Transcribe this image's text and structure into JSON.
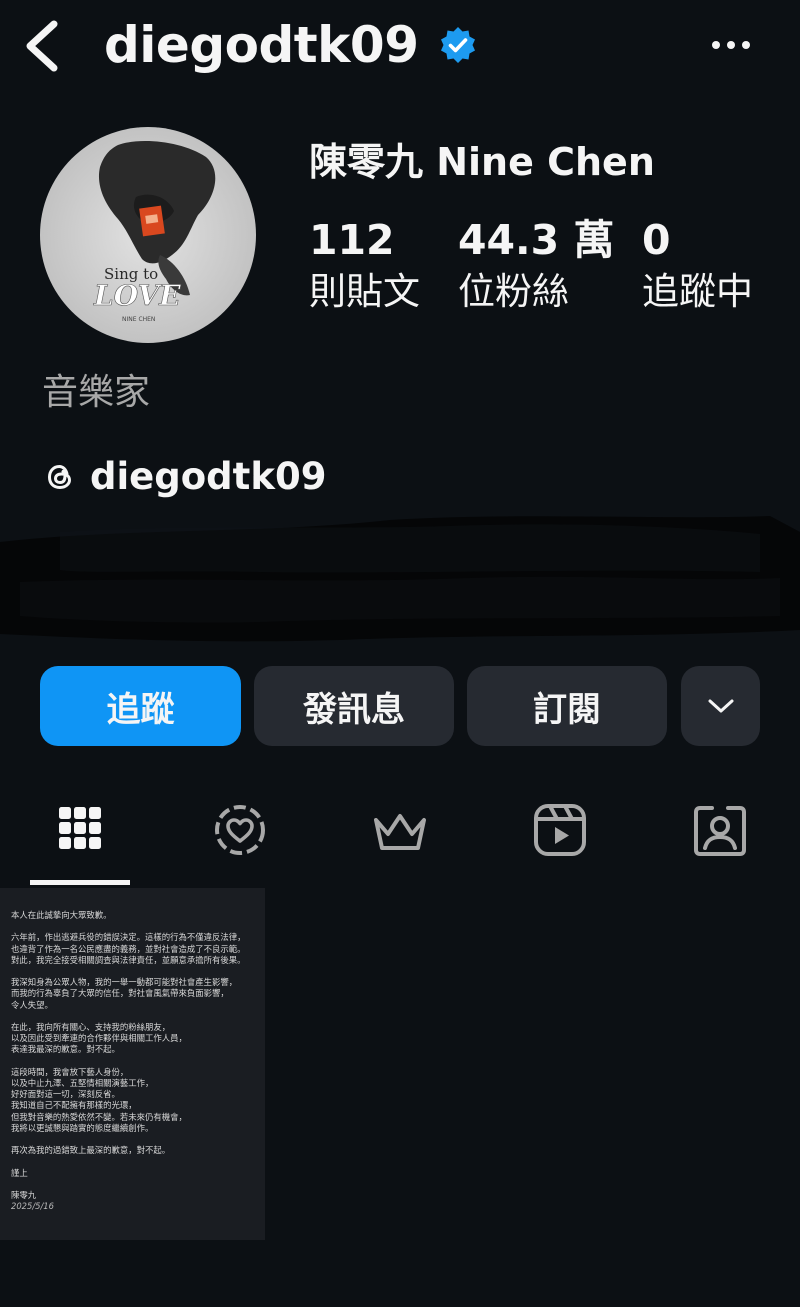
{
  "header": {
    "username": "diegodtk09",
    "back_icon": "chevron-left-icon",
    "verified_icon": "verified-badge-icon",
    "more_icon": "more-horizontal-icon"
  },
  "profile": {
    "avatar_text_1": "Sing to",
    "avatar_text_2": "LOVE",
    "avatar_text_3": "NINE CHEN",
    "full_name": "陳零九  Nine Chen",
    "stats": [
      {
        "value": "112",
        "label": "則貼文"
      },
      {
        "value": "44.3 萬",
        "label": "位粉絲"
      },
      {
        "value": "0",
        "label": "追蹤中"
      }
    ],
    "category": "音樂家",
    "threads_handle": "diegodtk09"
  },
  "actions": {
    "follow": "追蹤",
    "message": "發訊息",
    "subscribe": "訂閱",
    "accent_color": "#0f95f5"
  },
  "tabs": [
    "grid-icon",
    "highlights-icon",
    "subscriptions-icon",
    "reels-icon",
    "tagged-icon"
  ],
  "post": {
    "lines": [
      "本人在此誠摯向大眾致歉。",
      "",
      "六年前，作出逃避兵役的錯誤決定。這樣的行為不僅違反法律，",
      "也違背了作為一名公民應盡的義務，並對社會造成了不良示範。",
      "對此，我完全接受相關調查與法律責任，並願意承擔所有後果。",
      "",
      "我深知身為公眾人物，我的一舉一動都可能對社會產生影響，",
      "而我的行為辜負了大眾的信任，對社會風氣帶來負面影響，",
      "令人失望。",
      "",
      "在此，我向所有關心、支持我的粉絲朋友，",
      "以及因此受到牽連的合作夥伴與相關工作人員，",
      "表達我最深的歉意。對不起。",
      "",
      "這段時間，我會放下藝人身份，",
      "以及中止九澤、五堅情相關演藝工作，",
      "好好面對這一切，深刻反省。",
      "我知道自己不配擁有那樣的光環，",
      "但我對音樂的熱愛依然不變。若未來仍有機會，",
      "我將以更誠懇與踏實的態度繼續創作。",
      "",
      "再次為我的過錯致上最深的歉意，對不起。",
      "",
      "謹上",
      "",
      "陳零九"
    ],
    "date": "2025/5/16"
  }
}
